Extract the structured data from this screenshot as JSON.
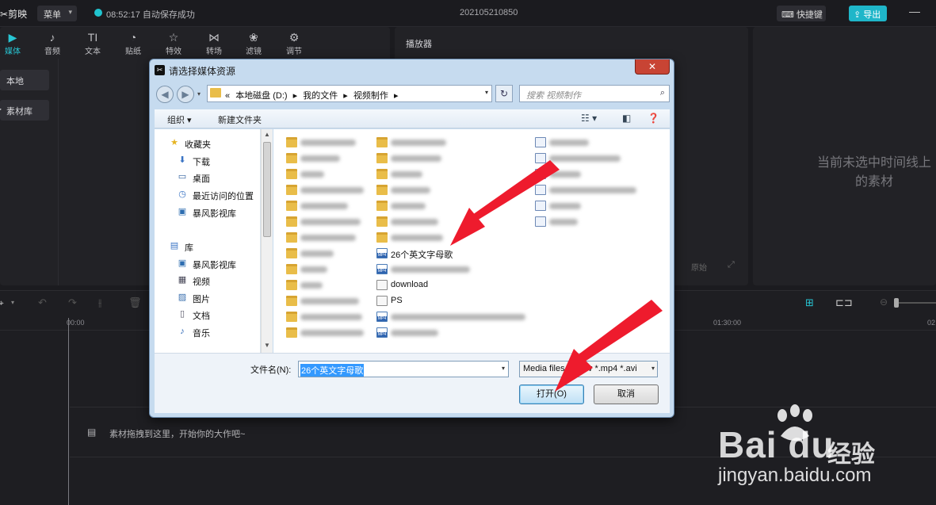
{
  "app": {
    "logo": "剪映",
    "menu_label": "菜单",
    "autosave": "08:52:17 自动保存成功",
    "project_title": "202105210850",
    "shortcut_label": "快捷键",
    "export_label": "导出"
  },
  "media_tools": [
    {
      "label": "媒体",
      "icon": "▶",
      "icon_name": "media-icon"
    },
    {
      "label": "音频",
      "icon": "♪",
      "icon_name": "audio-icon"
    },
    {
      "label": "文本",
      "icon": "TI",
      "icon_name": "text-icon"
    },
    {
      "label": "贴纸",
      "icon": "◔",
      "icon_name": "sticker-icon"
    },
    {
      "label": "特效",
      "icon": "☆",
      "icon_name": "effects-icon"
    },
    {
      "label": "转场",
      "icon": "⋈",
      "icon_name": "transition-icon"
    },
    {
      "label": "滤镜",
      "icon": "❀",
      "icon_name": "filter-icon"
    },
    {
      "label": "调节",
      "icon": "⚙",
      "icon_name": "adjust-icon"
    }
  ],
  "side_nav": [
    "本地",
    "素材库"
  ],
  "player": {
    "title": "播放器",
    "ratio_label": "原始"
  },
  "properties": {
    "empty_text": "当前未选中时间线上的素材"
  },
  "timeline": {
    "ticks": [
      "00:00",
      "01:30:00",
      "02"
    ],
    "drop_hint": "素材拖拽到这里，开始你的大作吧~"
  },
  "dialog": {
    "title": "请选择媒体资源",
    "address": [
      "«",
      "本地磁盘 (D:)",
      "▸",
      "我的文件",
      "▸",
      "视频制作",
      "▸"
    ],
    "search_placeholder": "搜索 视频制作",
    "organize": "组织 ▾",
    "new_folder": "新建文件夹",
    "nav": [
      {
        "label": "收藏夹",
        "icon": "★",
        "icon_name": "favorites-icon"
      },
      {
        "label": "下载",
        "icon": "⬇",
        "icon_name": "downloads-icon"
      },
      {
        "label": "桌面",
        "icon": "▭",
        "icon_name": "desktop-icon"
      },
      {
        "label": "最近访问的位置",
        "icon": "◷",
        "icon_name": "recent-icon"
      },
      {
        "label": "暴风影视库",
        "icon": "▣",
        "icon_name": "video-library-icon"
      },
      {
        "label": "库",
        "icon": "▤",
        "icon_name": "libraries-icon"
      },
      {
        "label": "暴风影视库",
        "icon": "▣",
        "icon_name": "video-library-icon"
      },
      {
        "label": "视频",
        "icon": "▦",
        "icon_name": "videos-icon"
      },
      {
        "label": "图片",
        "icon": "▨",
        "icon_name": "pictures-icon"
      },
      {
        "label": "文档",
        "icon": "▯",
        "icon_name": "documents-icon"
      },
      {
        "label": "音乐",
        "icon": "♪",
        "icon_name": "music-icon"
      }
    ],
    "files_visible": [
      {
        "name": "26个英文字母歌",
        "type": "video"
      },
      {
        "name": "download",
        "type": "shortcut"
      },
      {
        "name": "PS",
        "type": "shortcut"
      }
    ],
    "filename_label": "文件名(N):",
    "filename_value": "26个英文字母歌",
    "filetype_value": "Media files (*.mov *.mp4 *.avi",
    "open_button": "打开(O)",
    "cancel_button": "取消"
  },
  "watermark": {
    "brand": "Bai du",
    "jingyan": "经验",
    "url": "jingyan.baidu.com"
  },
  "colors": {
    "accent": "#28c6d4",
    "arrow": "#ee1b2d",
    "dialog_frame": "#c6dbef"
  }
}
